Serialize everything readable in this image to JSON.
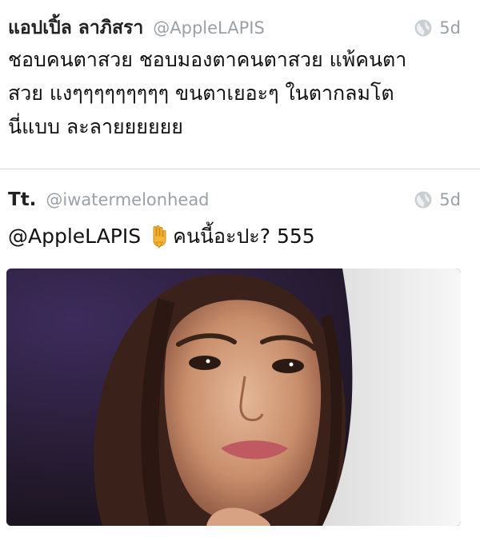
{
  "tweets": [
    {
      "display_name": "แอปเปิ้ล ลาภิสรา",
      "handle": "@AppleLAPIS",
      "time": "5d",
      "text_lines": [
        "ชอบคนตาสวย ชอบมองตาคนตาสวย แพ้คนตา",
        "สวย แงๆๆๆๆๆๆๆๆๆ ขนตาเยอะๆ ในตากลมโต",
        "นี่แบบ ละลายยยยยย"
      ]
    },
    {
      "display_name": "Tt.",
      "handle": "@iwatermelonhead",
      "time": "5d",
      "mention": "@AppleLAPIS",
      "emoji": "backhand-index-pointing-down",
      "text_after_emoji": "คนนี้อะปะ? 555"
    }
  ],
  "icons": {
    "public_icon": "globe-icon",
    "emoji_icon": "pointing-down-hand-icon"
  },
  "colors": {
    "muted": "#9aa0a6",
    "text": "#111111",
    "divider": "#d6d6d6"
  }
}
